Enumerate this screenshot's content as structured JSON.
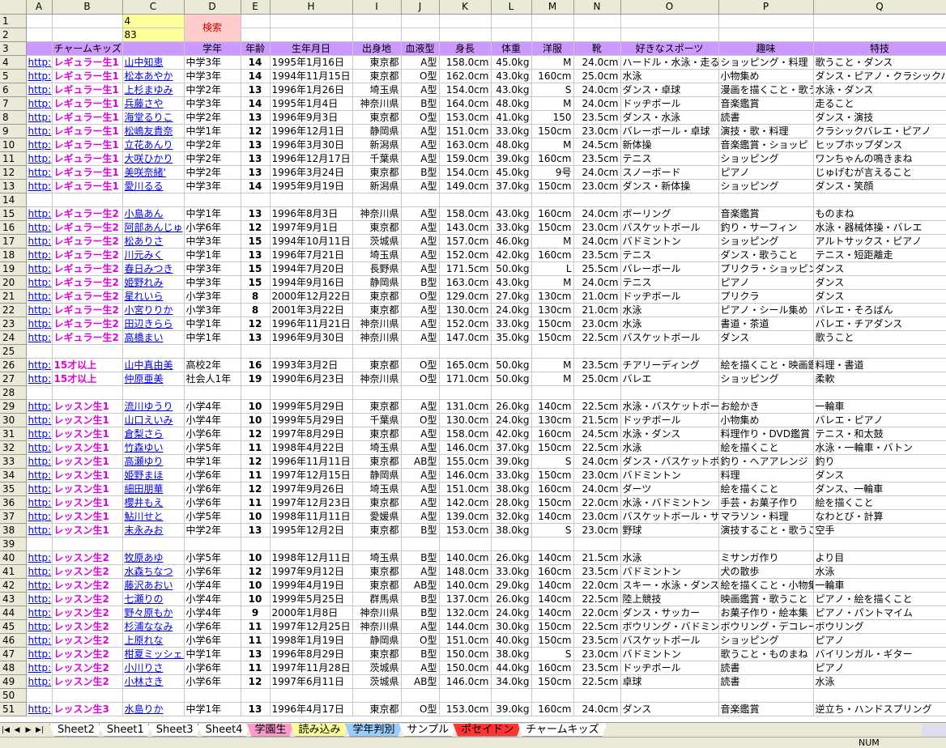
{
  "columns": [
    "A",
    "B",
    "C",
    "D",
    "E",
    "H",
    "I",
    "J",
    "K",
    "L",
    "M",
    "N",
    "O",
    "P",
    "Q"
  ],
  "c1": "4",
  "c2": "83",
  "search_label": "検索",
  "headers": {
    "B": "チャームキッズ",
    "D": "学年",
    "E": "年齢",
    "H": "生年月日",
    "I": "出身地",
    "J": "血液型",
    "K": "身長",
    "L": "体重",
    "M": "洋服",
    "N": "靴",
    "O": "好きなスポーツ",
    "P": "趣味",
    "Q": "特技"
  },
  "rows": [
    {
      "n": "4",
      "a": "http:",
      "b": "レギュラー生1",
      "c": "山中知恵",
      "d": "中学3年",
      "e": "14",
      "h": "1995年1月16日",
      "i": "東京都",
      "j": "A型",
      "k": "158.0cm",
      "l": "45.0kg",
      "m": "M",
      "nn": "24.0cm",
      "o": "ハードル・水泳・走る",
      "p": "ショッピング・料理",
      "q": "歌うこと・ダンス"
    },
    {
      "n": "5",
      "a": "http:",
      "b": "レギュラー生1",
      "c": "松本あやか",
      "d": "中学3年",
      "e": "14",
      "h": "1994年11月15日",
      "i": "東京都",
      "j": "O型",
      "k": "162.0cm",
      "l": "43.0kg",
      "m": "160cm",
      "nn": "25.0cm",
      "o": "水泳",
      "p": "小物集め",
      "q": "ダンス・ピアノ・クラシックバレ"
    },
    {
      "n": "6",
      "a": "http:",
      "b": "レギュラー生1",
      "c": "上杉まゆみ",
      "d": "中学2年",
      "e": "13",
      "h": "1996年1月26日",
      "i": "埼玉県",
      "j": "A型",
      "k": "154.0cm",
      "l": "43.0kg",
      "m": "S",
      "nn": "24.0cm",
      "o": "ダンス・卓球",
      "p": "漫画を描くこと・歌う",
      "q": "水泳・ダンス"
    },
    {
      "n": "7",
      "a": "http:",
      "b": "レギュラー生1",
      "c": "兵藤さや",
      "d": "中学3年",
      "e": "14",
      "h": "1995年1月4日",
      "i": "神奈川県",
      "j": "B型",
      "k": "164.0cm",
      "l": "48.0kg",
      "m": "M",
      "nn": "24.0cm",
      "o": "ドッヂボール",
      "p": "音楽鑑賞",
      "q": "走ること"
    },
    {
      "n": "8",
      "a": "http:",
      "b": "レギュラー生1",
      "c": "海堂るりこ",
      "d": "中学2年",
      "e": "13",
      "h": "1996年9月3日",
      "i": "東京都",
      "j": "O型",
      "k": "153.0cm",
      "l": "41.0kg",
      "m": "150",
      "nn": "23.5cm",
      "o": "ダンス・水泳",
      "p": "読書",
      "q": "ダンス・演技"
    },
    {
      "n": "9",
      "a": "http:",
      "b": "レギュラー生1",
      "c": "松嶋友貴奈",
      "d": "中学1年",
      "e": "12",
      "h": "1996年12月1日",
      "i": "静岡県",
      "j": "A型",
      "k": "151.0cm",
      "l": "33.0kg",
      "m": "150cm",
      "nn": "23.0cm",
      "o": "バレーボール・卓球",
      "p": "演技・歌・料理",
      "q": "クラシックバレエ・ピアノ"
    },
    {
      "n": "10",
      "a": "http:",
      "b": "レギュラー生1",
      "c": "立花あんり",
      "d": "中学2年",
      "e": "13",
      "h": "1996年3月30日",
      "i": "新潟県",
      "j": "A型",
      "k": "163.0cm",
      "l": "48.0kg",
      "m": "M",
      "nn": "24.5cm",
      "o": "新体操",
      "p": "音楽鑑賞・ショッピ",
      "q": "ヒップホップダンス"
    },
    {
      "n": "11",
      "a": "http:",
      "b": "レギュラー生1",
      "c": "大咲ひかり",
      "d": "中学2年",
      "e": "13",
      "h": "1996年12月17日",
      "i": "千葉県",
      "j": "A型",
      "k": "159.0cm",
      "l": "39.0kg",
      "m": "160cm",
      "nn": "23.5cm",
      "o": "テニス",
      "p": "ショッピング",
      "q": "ワンちゃんの鳴きまね"
    },
    {
      "n": "12",
      "a": "http:",
      "b": "レギュラー生1",
      "c": "美咲奈緒'",
      "d": "中学2年",
      "e": "13",
      "h": "1996年3月24日",
      "i": "東京都",
      "j": "B型",
      "k": "154.0cm",
      "l": "45.0kg",
      "m": "9号",
      "nn": "24.0cm",
      "o": "スノーボード",
      "p": "ピアノ",
      "q": "じゅげむが言えること"
    },
    {
      "n": "13",
      "a": "http:",
      "b": "レギュラー生1",
      "c": "愛川るる",
      "d": "中学3年",
      "e": "14",
      "h": "1995年9月19日",
      "i": "新潟県",
      "j": "A型",
      "k": "149.0cm",
      "l": "37.0kg",
      "m": "150cm",
      "nn": "23.0cm",
      "o": "ダンス・新体操",
      "p": "ショッピング",
      "q": "ダンス・笑顔"
    },
    {
      "n": "14"
    },
    {
      "n": "15",
      "a": "http:",
      "b": "レギュラー生2",
      "c": "小島あん",
      "d": "中学1年",
      "e": "13",
      "h": "1996年8月3日",
      "i": "神奈川県",
      "j": "A型",
      "k": "158.0cm",
      "l": "43.0kg",
      "m": "160cm",
      "nn": "24.0cm",
      "o": "ボーリング",
      "p": "音楽鑑賞",
      "q": "ものまね"
    },
    {
      "n": "16",
      "a": "http:",
      "b": "レギュラー生2",
      "c": "阿部あんじゅ",
      "d": "小学6年",
      "e": "12",
      "h": "1997年9月1日",
      "i": "東京都",
      "j": "A型",
      "k": "143.0cm",
      "l": "33.0kg",
      "m": "150cm",
      "nn": "23.0cm",
      "o": "バスケットボール",
      "p": "釣り・サーフィン",
      "q": "水泳・器械体操・バレエ"
    },
    {
      "n": "17",
      "a": "http:",
      "b": "レギュラー生2",
      "c": "松ありさ",
      "d": "中学3年",
      "e": "15",
      "h": "1994年10月11日",
      "i": "茨城県",
      "j": "A型",
      "k": "157.0cm",
      "l": "46.0kg",
      "m": "M",
      "nn": "24.0cm",
      "o": "バドミントン",
      "p": "ショッピング",
      "q": "アルトサックス・ピアノ"
    },
    {
      "n": "18",
      "a": "http:",
      "b": "レギュラー生2",
      "c": "川元みく",
      "d": "中学1年",
      "e": "13",
      "h": "1996年7月21日",
      "i": "埼玉県",
      "j": "A型",
      "k": "152.0cm",
      "l": "42.0kg",
      "m": "160cm",
      "nn": "23.5cm",
      "o": "テニス",
      "p": "ダンス・歌うこと",
      "q": "テニス・短距離走"
    },
    {
      "n": "19",
      "a": "http:",
      "b": "レギュラー生2",
      "c": "春日みつき",
      "d": "中学3年",
      "e": "15",
      "h": "1994年7月20日",
      "i": "長野県",
      "j": "A型",
      "k": "171.5cm",
      "l": "50.0kg",
      "m": "L",
      "nn": "25.5cm",
      "o": "バレーボール",
      "p": "プリクラ・ショッピング",
      "q": "ダンス"
    },
    {
      "n": "20",
      "a": "http:",
      "b": "レギュラー生2",
      "c": "姫野れみ",
      "d": "中学3年",
      "e": "15",
      "h": "1994年9月16日",
      "i": "静岡県",
      "j": "B型",
      "k": "163.0cm",
      "l": "43.0kg",
      "m": "M",
      "nn": "24.0cm",
      "o": "テニス",
      "p": "ピアノ",
      "q": "ダンス"
    },
    {
      "n": "21",
      "a": "http:",
      "b": "レギュラー生2",
      "c": "星れいら",
      "d": "小学3年",
      "e": "8",
      "h": "2000年12月22日",
      "i": "東京都",
      "j": "O型",
      "k": "129.0cm",
      "l": "27.0kg",
      "m": "130cm",
      "nn": "21.0cm",
      "o": "ドッヂボール",
      "p": "プリクラ",
      "q": "ダンス"
    },
    {
      "n": "22",
      "a": "http:",
      "b": "レギュラー生2",
      "c": "小宮りりか",
      "d": "小学3年",
      "e": "8",
      "h": "2001年3月22日",
      "i": "東京都",
      "j": "A型",
      "k": "130.0cm",
      "l": "24.0kg",
      "m": "130cm",
      "nn": "21.0cm",
      "o": "水泳",
      "p": "ピアノ・シール集め",
      "q": "バレエ・そろばん"
    },
    {
      "n": "23",
      "a": "http:",
      "b": "レギュラー生2",
      "c": "田辺きらら",
      "d": "中学1年",
      "e": "12",
      "h": "1996年11月21日",
      "i": "神奈川県",
      "j": "A型",
      "k": "152.0cm",
      "l": "33.0kg",
      "m": "150cm",
      "nn": "23.0cm",
      "o": "水泳",
      "p": "書道・茶道",
      "q": "バレエ・チアダンス"
    },
    {
      "n": "24",
      "a": "http:",
      "b": "レギュラー生2",
      "c": "高橋まい",
      "d": "中学1年",
      "e": "13",
      "h": "1996年9月30日",
      "i": "神奈川県",
      "j": "A型",
      "k": "147.0cm",
      "l": "35.0kg",
      "m": "150cm",
      "nn": "22.5cm",
      "o": "バスケットボール",
      "p": "ダンス",
      "q": "歌うこと"
    },
    {
      "n": "25"
    },
    {
      "n": "26",
      "a": "http:",
      "b": "15才以上",
      "c": "山中真由美",
      "d": "高校2年",
      "e": "16",
      "h": "1993年3月2日",
      "i": "東京都",
      "j": "O型",
      "k": "165.0cm",
      "l": "50.0kg",
      "m": "M",
      "nn": "23.5cm",
      "o": "チアリーディング",
      "p": "絵を描くこと・映画鑑",
      "q": "料理・書道"
    },
    {
      "n": "27",
      "a": "http:",
      "b": "15才以上",
      "c": "仲原亜美",
      "d": "社会人1年",
      "e": "19",
      "h": "1990年6月23日",
      "i": "神奈川県",
      "j": "O型",
      "k": "171.0cm",
      "l": "50.0kg",
      "m": "M",
      "nn": "25.0cm",
      "o": "バレエ",
      "p": "ショッピング",
      "q": "柔軟"
    },
    {
      "n": "28"
    },
    {
      "n": "29",
      "a": "http:",
      "b": "レッスン生1",
      "c": "流川ゆうり",
      "d": "小学4年",
      "e": "10",
      "h": "1999年5月29日",
      "i": "東京都",
      "j": "A型",
      "k": "131.0cm",
      "l": "26.0kg",
      "m": "140cm",
      "nn": "22.5cm",
      "o": "水泳・バスケットボー",
      "p": "お絵かき",
      "q": "一輪車"
    },
    {
      "n": "30",
      "a": "http:",
      "b": "レッスン生1",
      "c": "山口えいみ",
      "d": "小学4年",
      "e": "10",
      "h": "1999年5月29日",
      "i": "千葉県",
      "j": "O型",
      "k": "130.0cm",
      "l": "24.0kg",
      "m": "130cm",
      "nn": "21.5cm",
      "o": "ドッヂボール",
      "p": "小物集め",
      "q": "バレエ・ピアノ"
    },
    {
      "n": "31",
      "a": "http:",
      "b": "レッスン生1",
      "c": "倉梨さら",
      "d": "小学6年",
      "e": "12",
      "h": "1997年8月29日",
      "i": "東京都",
      "j": "A型",
      "k": "158.0cm",
      "l": "42.0kg",
      "m": "160cm",
      "nn": "24.5cm",
      "o": "水泳・ダンス",
      "p": "料理作り・DVD鑑賞",
      "q": "テニス・和太鼓"
    },
    {
      "n": "32",
      "a": "http:",
      "b": "レッスン生1",
      "c": "竹森ゆい",
      "d": "小学5年",
      "e": "11",
      "h": "1998年4月22日",
      "i": "埼玉県",
      "j": "A型",
      "k": "146.0cm",
      "l": "37.0kg",
      "m": "150cm",
      "nn": "22.5cm",
      "o": "水泳",
      "p": "絵を描くこと",
      "q": "水泳・一輪車・バトン"
    },
    {
      "n": "33",
      "a": "http:",
      "b": "レッスン生1",
      "c": "高瀬ゆり",
      "d": "中学1年",
      "e": "12",
      "h": "1996年11月11日",
      "i": "東京都",
      "j": "AB型",
      "k": "155.0cm",
      "l": "39.0kg",
      "m": "S",
      "nn": "24.0cm",
      "o": "ダンス・バスケットボ",
      "p": "釣り・ヘアアレンジ",
      "q": "釣り"
    },
    {
      "n": "34",
      "a": "http:",
      "b": "レッスン生1",
      "c": "姫野まほ",
      "d": "小学6年",
      "e": "11",
      "h": "1997年12月15日",
      "i": "静岡県",
      "j": "A型",
      "k": "146.0cm",
      "l": "33.0kg",
      "m": "150cm",
      "nn": "23.0cm",
      "o": "バドミントン",
      "p": "料理",
      "q": "ダンス"
    },
    {
      "n": "35",
      "a": "http:",
      "b": "レッスン生1",
      "c": "細田朋華",
      "d": "小学6年",
      "e": "12",
      "h": "1997年9月26日",
      "i": "埼玉県",
      "j": "A型",
      "k": "151.0cm",
      "l": "38.0kg",
      "m": "160cm",
      "nn": "24.0cm",
      "o": "ダーツ",
      "p": "絵を描くこと",
      "q": "ダンス、一輪車"
    },
    {
      "n": "36",
      "a": "http:",
      "b": "レッスン生1",
      "c": "櫻井もえ",
      "d": "小学6年",
      "e": "11",
      "h": "1997年12月23日",
      "i": "東京都",
      "j": "A型",
      "k": "142.0cm",
      "l": "28.0kg",
      "m": "150cm",
      "nn": "22.0cm",
      "o": "水泳・バドミントン",
      "p": "手芸・お菓子作り",
      "q": "絵を描くこと"
    },
    {
      "n": "37",
      "a": "http:",
      "b": "レッスン生1",
      "c": "鮎川せと",
      "d": "小学5年",
      "e": "10",
      "h": "1998年11月11日",
      "i": "愛媛県",
      "j": "A型",
      "k": "139.0cm",
      "l": "32.0kg",
      "m": "140cm",
      "nn": "23.0cm",
      "o": "バスケットボール・サ",
      "p": "マラソン・料理",
      "q": "なわとび・計算"
    },
    {
      "n": "38",
      "a": "http:",
      "b": "レッスン生1",
      "c": "末永みお",
      "d": "中学2年",
      "e": "13",
      "h": "1995年12月2日",
      "i": "東京都",
      "j": "B型",
      "k": "153.0cm",
      "l": "38.0kg",
      "m": "S",
      "nn": "23.0cm",
      "o": "野球",
      "p": "演技すること・歌うこ",
      "q": "空手"
    },
    {
      "n": "39"
    },
    {
      "n": "40",
      "a": "http:",
      "b": "レッスン生2",
      "c": "牧原あゆ",
      "d": "小学5年",
      "e": "10",
      "h": "1998年12月11日",
      "i": "埼玉県",
      "j": "B型",
      "k": "140.0cm",
      "l": "26.0kg",
      "m": "140cm",
      "nn": "21.5cm",
      "o": "水泳",
      "p": "ミサンガ作り",
      "q": "より目"
    },
    {
      "n": "41",
      "a": "http:",
      "b": "レッスン生2",
      "c": "水森ちなつ",
      "d": "小学6年",
      "e": "12",
      "h": "1997年9月12日",
      "i": "東京都",
      "j": "A型",
      "k": "148.0cm",
      "l": "33.0kg",
      "m": "160cm",
      "nn": "23.5cm",
      "o": "バドミントン",
      "p": "犬の散歩",
      "q": "水泳"
    },
    {
      "n": "42",
      "a": "http:",
      "b": "レッスン生2",
      "c": "藤沢あおい",
      "d": "小学4年",
      "e": "10",
      "h": "1999年4月19日",
      "i": "東京都",
      "j": "AB型",
      "k": "140.0cm",
      "l": "29.0kg",
      "m": "140cm",
      "nn": "22.0cm",
      "o": "スキー・水泳・ダンス",
      "p": "絵を描くこと・小物集",
      "q": "一輪車"
    },
    {
      "n": "43",
      "a": "http:",
      "b": "レッスン生2",
      "c": "七瀬りの",
      "d": "小学4年",
      "e": "10",
      "h": "1999年5月25日",
      "i": "群馬県",
      "j": "B型",
      "k": "137.0cm",
      "l": "26.0kg",
      "m": "140cm",
      "nn": "22.5cm",
      "o": "陸上競技",
      "p": "映画鑑賞・歌うこと",
      "q": "ピアノ・絵を描くこと"
    },
    {
      "n": "44",
      "a": "http:",
      "b": "レッスン生2",
      "c": "野々原もか",
      "d": "小学4年",
      "e": "9",
      "h": "2000年1月8日",
      "i": "神奈川県",
      "j": "B型",
      "k": "132.0cm",
      "l": "24.0kg",
      "m": "140cm",
      "nn": "22.0cm",
      "o": "ダンス・サッカー",
      "p": "お菓子作り・絵本集",
      "q": "ピアノ・パントマイム"
    },
    {
      "n": "45",
      "a": "http:",
      "b": "レッスン生2",
      "c": "杉浦ななみ",
      "d": "小学6年",
      "e": "11",
      "h": "1997年12月25日",
      "i": "神奈川県",
      "j": "A型",
      "k": "144.0cm",
      "l": "30.0kg",
      "m": "150cm",
      "nn": "22.5cm",
      "o": "ボウリング・バドミント",
      "p": "ボウリング・デコレー",
      "q": "ボウリング"
    },
    {
      "n": "46",
      "a": "http:",
      "b": "レッスン生2",
      "c": "上原れな",
      "d": "小学6年",
      "e": "11",
      "h": "1998年1月19日",
      "i": "静岡県",
      "j": "O型",
      "k": "151.0cm",
      "l": "40.0kg",
      "m": "150cm",
      "nn": "23.5cm",
      "o": "バスケットボール",
      "p": "ショッピング",
      "q": "ピアノ"
    },
    {
      "n": "47",
      "a": "http:",
      "b": "レッスン生2",
      "c": "柑夏ミッシェル",
      "d": "中学1年",
      "e": "13",
      "h": "1996年8月29日",
      "i": "東京都",
      "j": "B型",
      "k": "150.0cm",
      "l": "38.0kg",
      "m": "S",
      "nn": "23.0cm",
      "o": "バドミントン",
      "p": "歌うこと・ものまね",
      "q": "バイリンガル・ギター"
    },
    {
      "n": "48",
      "a": "http:",
      "b": "レッスン生2",
      "c": "小川りさ",
      "d": "小学6年",
      "e": "11",
      "h": "1997年11月28日",
      "i": "茨城県",
      "j": "A型",
      "k": "150.0cm",
      "l": "44.0kg",
      "m": "160cm",
      "nn": "23.5cm",
      "o": "ドッヂボール",
      "p": "読書",
      "q": "ピアノ"
    },
    {
      "n": "49",
      "a": "http:",
      "b": "レッスン生2",
      "c": "小林さき",
      "d": "小学6年",
      "e": "12",
      "h": "1997年6月11日",
      "i": "茨城県",
      "j": "AB型",
      "k": "146.0cm",
      "l": "34.0kg",
      "m": "150cm",
      "nn": "22.5cm",
      "o": "卓球",
      "p": "読書",
      "q": "水泳"
    },
    {
      "n": "50"
    },
    {
      "n": "51",
      "a": "http:",
      "b": "レッスン生3",
      "c": "水島りか",
      "d": "中学1年",
      "e": "13",
      "h": "1996年4月17日",
      "i": "東京都",
      "j": "O型",
      "k": "153.0cm",
      "l": "39.0kg",
      "m": "160cm",
      "nn": "24.0cm",
      "o": "ダンス",
      "p": "音楽鑑賞",
      "q": "逆立ち・ハンドスプリング"
    }
  ],
  "sheet_tabs": [
    {
      "label": "Sheet2",
      "bg": "#ffffff"
    },
    {
      "label": "Sheet1",
      "bg": "#ffffff"
    },
    {
      "label": "Sheet3",
      "bg": "#ffffff"
    },
    {
      "label": "Sheet4",
      "bg": "#ffffff"
    },
    {
      "label": "学園生",
      "bg": "#ff99cc"
    },
    {
      "label": "読み込み",
      "bg": "#ffff99"
    },
    {
      "label": "学年判別",
      "bg": "#99ccff"
    },
    {
      "label": "サンプル",
      "bg": "#ffffff"
    },
    {
      "label": "ポセイドン",
      "bg": "#ff3333"
    },
    {
      "label": "チャームキッズ",
      "bg": "#ffffff"
    }
  ],
  "status_text": "NUM",
  "colors": {
    "header_band": "#cc99ff",
    "group_label": "#e000e0",
    "link": "#0000ee",
    "ui_face": "#ece9d8"
  }
}
